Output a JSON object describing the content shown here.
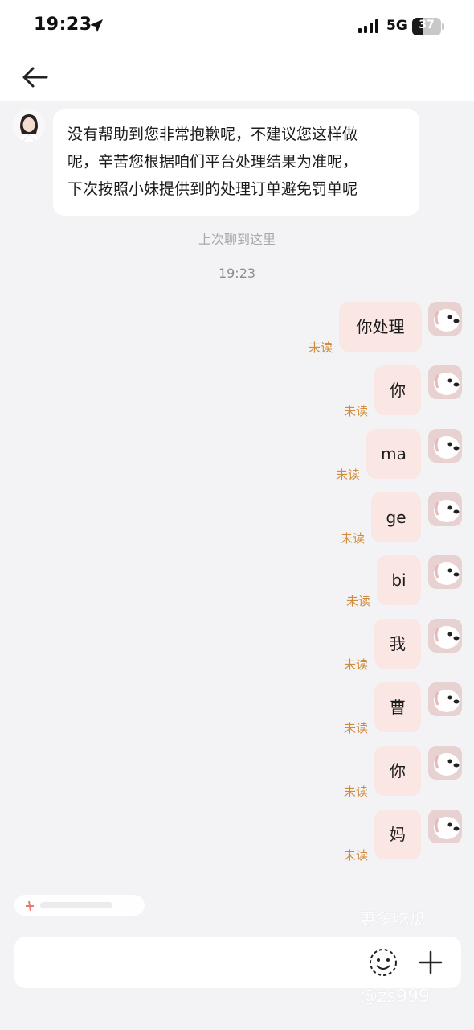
{
  "status_bar": {
    "time": "19:23",
    "network": "5G",
    "battery": "37",
    "icons": [
      "location-arrow-icon",
      "signal-icon",
      "battery-icon"
    ]
  },
  "nav": {
    "back_icon": "arrow-left-icon"
  },
  "incoming": {
    "lines": [
      "没有帮助到您非常抱歉呢，不建议您这样做",
      "呢，辛苦您根据咱们平台处理结果为准呢，",
      "下次按照小妹提供到的处理订单避免罚单呢"
    ]
  },
  "divider_text": "上次聊到这里",
  "timestamp": "19:23",
  "unread_label": "未读",
  "outgoing": [
    {
      "text": "你处理"
    },
    {
      "text": "你"
    },
    {
      "text": "ma"
    },
    {
      "text": "ge"
    },
    {
      "text": "bi"
    },
    {
      "text": "我"
    },
    {
      "text": "曹"
    },
    {
      "text": "你"
    },
    {
      "text": "妈"
    }
  ],
  "footer": {
    "more_link": "更多吃瓜",
    "watermark": "@zs999",
    "input_value": "",
    "icons": [
      "emoji-icon",
      "plus-icon"
    ]
  },
  "colors": {
    "background": "#f3f3f6",
    "outgoing_bubble": "#fae6e3",
    "unread": "#d08a3a"
  }
}
